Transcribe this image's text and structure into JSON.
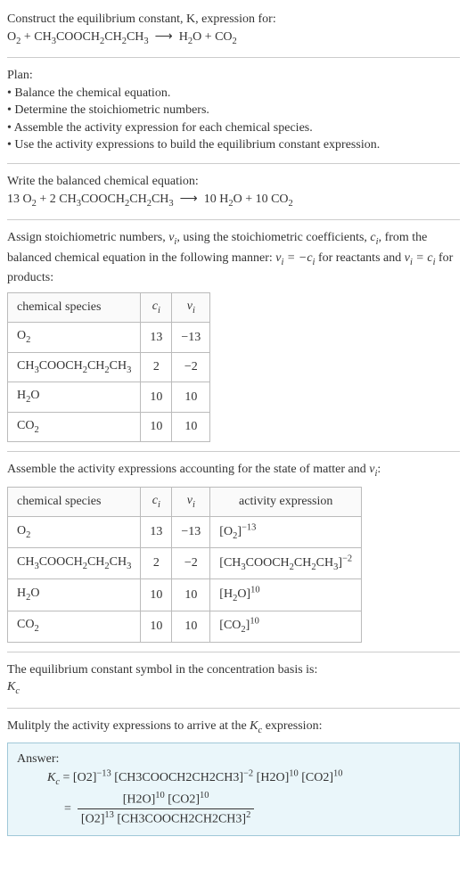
{
  "intro": {
    "line1": "Construct the equilibrium constant, K, expression for:",
    "equation": "O₂ + CH₃COOCH₂CH₂CH₃  ⟶  H₂O + CO₂"
  },
  "plan": {
    "heading": "Plan:",
    "items": [
      "• Balance the chemical equation.",
      "• Determine the stoichiometric numbers.",
      "• Assemble the activity expression for each chemical species.",
      "• Use the activity expressions to build the equilibrium constant expression."
    ]
  },
  "balanced": {
    "heading": "Write the balanced chemical equation:",
    "equation": "13 O₂ + 2 CH₃COOCH₂CH₂CH₃  ⟶  10 H₂O + 10 CO₂"
  },
  "stoich": {
    "intro_a": "Assign stoichiometric numbers, ",
    "intro_b": ", using the stoichiometric coefficients, ",
    "intro_c": ", from the balanced chemical equation in the following manner: ",
    "intro_d": " for reactants and ",
    "intro_e": " for products:",
    "nu": "ν",
    "c": "c",
    "eq1a": "νᵢ = −cᵢ",
    "eq1b": "νᵢ = cᵢ",
    "headers": [
      "chemical species",
      "cᵢ",
      "νᵢ"
    ],
    "rows": [
      {
        "species": "O₂",
        "c": "13",
        "nu": "−13"
      },
      {
        "species": "CH₃COOCH₂CH₂CH₃",
        "c": "2",
        "nu": "−2"
      },
      {
        "species": "H₂O",
        "c": "10",
        "nu": "10"
      },
      {
        "species": "CO₂",
        "c": "10",
        "nu": "10"
      }
    ]
  },
  "activity": {
    "heading": "Assemble the activity expressions accounting for the state of matter and νᵢ:",
    "headers": [
      "chemical species",
      "cᵢ",
      "νᵢ",
      "activity expression"
    ],
    "rows": [
      {
        "species": "O₂",
        "c": "13",
        "nu": "−13",
        "expr": "[O₂]⁻¹³"
      },
      {
        "species": "CH₃COOCH₂CH₂CH₃",
        "c": "2",
        "nu": "−2",
        "expr": "[CH₃COOCH₂CH₂CH₃]⁻²"
      },
      {
        "species": "H₂O",
        "c": "10",
        "nu": "10",
        "expr": "[H₂O]¹⁰"
      },
      {
        "species": "CO₂",
        "c": "10",
        "nu": "10",
        "expr": "[CO₂]¹⁰"
      }
    ]
  },
  "symbol": {
    "line": "The equilibrium constant symbol in the concentration basis is:",
    "kc": "K꜀"
  },
  "final": {
    "heading": "Mulitply the activity expressions to arrive at the K꜀ expression:",
    "answer_label": "Answer:",
    "line1_lhs": "K꜀ = ",
    "line1_rhs": "[O₂]⁻¹³ [CH₃COOCH₂CH₂CH₃]⁻² [H₂O]¹⁰ [CO₂]¹⁰",
    "eq_sign": "= ",
    "frac_num": "[H₂O]¹⁰ [CO₂]¹⁰",
    "frac_den": "[O₂]¹³ [CH₃COOCH₂CH₂CH₃]²"
  }
}
